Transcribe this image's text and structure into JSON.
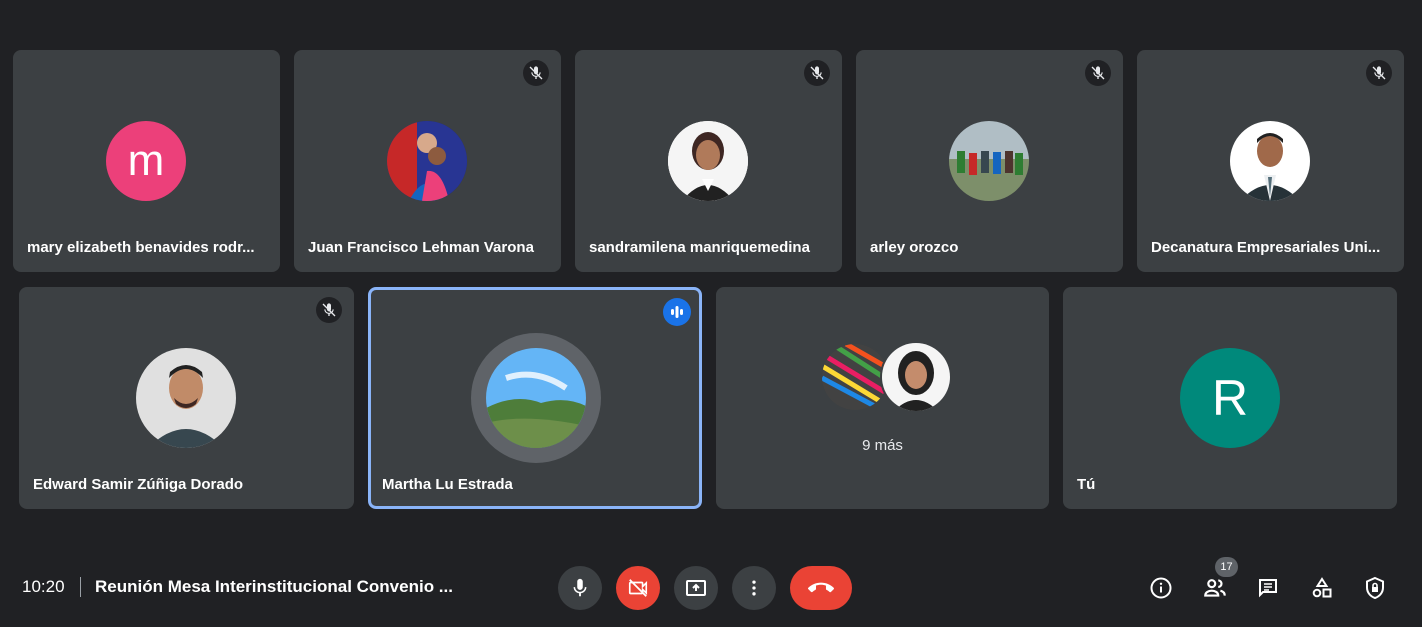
{
  "participants_top": [
    {
      "name": "mary elizabeth benavides rodr...",
      "avatar_letter": "m",
      "avatar_color": "#ec407a"
    },
    {
      "name": "Juan Francisco Lehman Varona"
    },
    {
      "name": "sandramilena manriquemedina"
    },
    {
      "name": "arley orozco"
    },
    {
      "name": "Decanatura Empresariales Uni..."
    }
  ],
  "participants_bottom": [
    {
      "name": "Edward Samir Zúñiga Dorado"
    },
    {
      "name": "Martha Lu Estrada",
      "speaking": true
    },
    {
      "more_label": "9 más"
    },
    {
      "name": "Tú",
      "avatar_letter": "R",
      "avatar_color": "#00897b"
    }
  ],
  "bottom_bar": {
    "time": "10:20",
    "meeting_title": "Reunión Mesa Interinstitucional Convenio ...",
    "participants_count": "17"
  },
  "colors": {
    "background": "#202124",
    "tile": "#3c4043",
    "active_border": "#8ab4f8",
    "hangup": "#ea4335",
    "speaking": "#1a73e8"
  },
  "icons": [
    "mic-off-icon",
    "speaking-icon",
    "mic-icon",
    "camera-off-icon",
    "present-icon",
    "more-vert-icon",
    "call-end-icon",
    "info-icon",
    "people-icon",
    "chat-icon",
    "activities-icon",
    "host-controls-icon"
  ]
}
